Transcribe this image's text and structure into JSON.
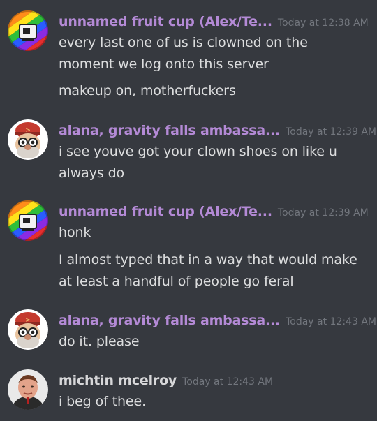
{
  "colors": {
    "background": "#36393f",
    "username_purple": "#b48ad6",
    "username_default": "#d7d7d9",
    "timestamp": "#72767d",
    "message_text": "#dcddde"
  },
  "messages": [
    {
      "username": "unnamed fruit cup (Alex/Te...",
      "timestamp": "Today at 12:38 AM",
      "avatar_icon": "rainbow-computer-avatar",
      "lines": [
        "every last one of us is clowned on the moment we log onto this server",
        "makeup on, motherfuckers"
      ]
    },
    {
      "username": "alana, gravity falls ambassa...",
      "timestamp": "Today at 12:39 AM",
      "avatar_icon": "cartoon-old-man-avatar",
      "lines": [
        "i see youve got your clown shoes on like u always do"
      ]
    },
    {
      "username": "unnamed fruit cup (Alex/Te...",
      "timestamp": "Today at 12:39 AM",
      "avatar_icon": "rainbow-computer-avatar",
      "lines": [
        "honk",
        "I almost typed that in a way that would make at least a handful of people go feral"
      ]
    },
    {
      "username": "alana, gravity falls ambassa...",
      "timestamp": "Today at 12:43 AM",
      "avatar_icon": "cartoon-old-man-avatar",
      "lines": [
        "do it. please"
      ]
    },
    {
      "username": "michtin mcelroy",
      "timestamp": "Today at 12:43 AM",
      "avatar_icon": "photo-person-avatar",
      "lines": [
        "i beg of thee."
      ]
    }
  ]
}
